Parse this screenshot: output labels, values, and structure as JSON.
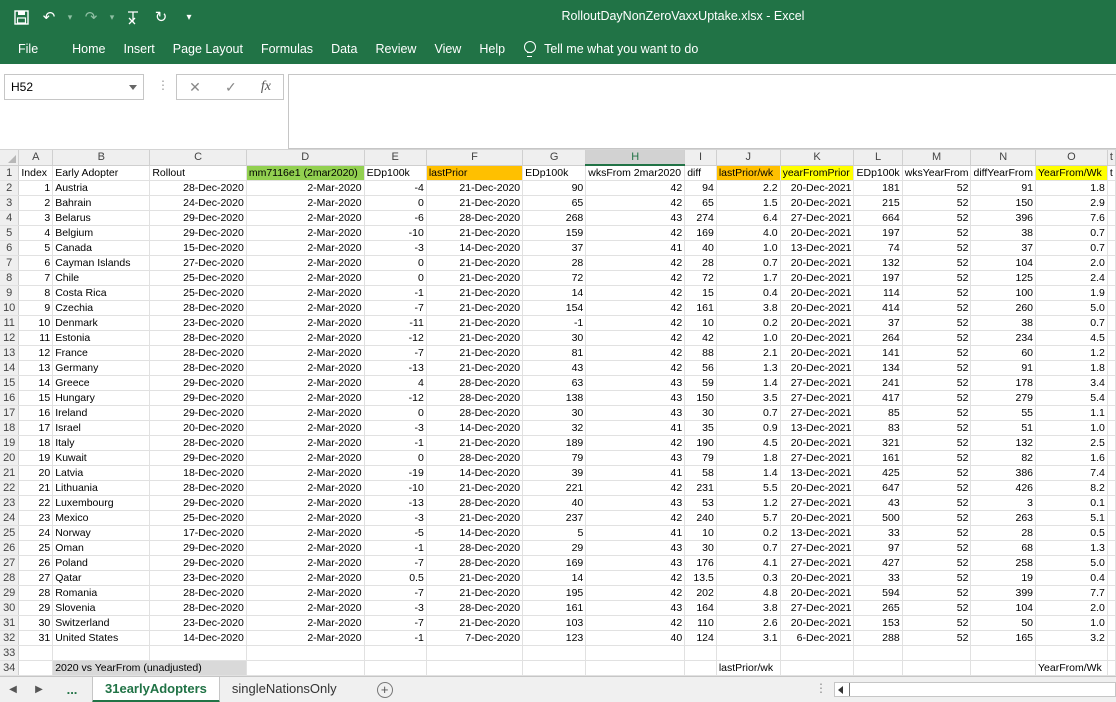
{
  "app": {
    "title": "RolloutDayNonZeroVaxxUptake.xlsx  -  Excel",
    "accent_color": "#217346"
  },
  "qat": {
    "icons": [
      "save-icon",
      "undo-icon",
      "redo-icon",
      "clear-format-icon",
      "refresh-icon",
      "customize-qat-icon"
    ]
  },
  "menu": {
    "items": [
      "File",
      "Home",
      "Insert",
      "Page Layout",
      "Formulas",
      "Data",
      "Review",
      "View",
      "Help"
    ],
    "tell_me": "Tell me what you want to do"
  },
  "formula_bar": {
    "name_box": "H52",
    "fx_label": "fx",
    "value": ""
  },
  "columns": [
    "A",
    "B",
    "C",
    "D",
    "E",
    "F",
    "G",
    "H",
    "I",
    "J",
    "K",
    "L",
    "M",
    "N",
    "O",
    "t"
  ],
  "selected_column": "H",
  "header_row": {
    "row_num": "1",
    "cells": [
      "Index",
      "Early Adopter",
      "Rollout",
      "mm7116e1 (2mar2020)",
      "EDp100k",
      "lastPrior",
      "EDp100k",
      "wksFrom 2mar2020",
      "diff",
      "lastPrior/wk",
      "yearFromPrior",
      "EDp100k",
      "wksYearFrom",
      "diffYearFrom",
      "YearFrom/Wk",
      "t"
    ],
    "highlight_colors": {
      "D": "#92d050",
      "F": "#ffc000",
      "J": "#ffc000",
      "K": "#ffff00",
      "O": "#ffff00"
    }
  },
  "rows": [
    [
      "2",
      "1",
      "Austria",
      "28-Dec-2020",
      "2-Mar-2020",
      "-4",
      "21-Dec-2020",
      "90",
      "42",
      "94",
      "2.2",
      "20-Dec-2021",
      "181",
      "52",
      "91",
      "1.8"
    ],
    [
      "3",
      "2",
      "Bahrain",
      "24-Dec-2020",
      "2-Mar-2020",
      "0",
      "21-Dec-2020",
      "65",
      "42",
      "65",
      "1.5",
      "20-Dec-2021",
      "215",
      "52",
      "150",
      "2.9"
    ],
    [
      "4",
      "3",
      "Belarus",
      "29-Dec-2020",
      "2-Mar-2020",
      "-6",
      "28-Dec-2020",
      "268",
      "43",
      "274",
      "6.4",
      "27-Dec-2021",
      "664",
      "52",
      "396",
      "7.6"
    ],
    [
      "5",
      "4",
      "Belgium",
      "29-Dec-2020",
      "2-Mar-2020",
      "-10",
      "21-Dec-2020",
      "159",
      "42",
      "169",
      "4.0",
      "20-Dec-2021",
      "197",
      "52",
      "38",
      "0.7"
    ],
    [
      "6",
      "5",
      "Canada",
      "15-Dec-2020",
      "2-Mar-2020",
      "-3",
      "14-Dec-2020",
      "37",
      "41",
      "40",
      "1.0",
      "13-Dec-2021",
      "74",
      "52",
      "37",
      "0.7"
    ],
    [
      "7",
      "6",
      "Cayman Islands",
      "27-Dec-2020",
      "2-Mar-2020",
      "0",
      "21-Dec-2020",
      "28",
      "42",
      "28",
      "0.7",
      "20-Dec-2021",
      "132",
      "52",
      "104",
      "2.0"
    ],
    [
      "8",
      "7",
      "Chile",
      "25-Dec-2020",
      "2-Mar-2020",
      "0",
      "21-Dec-2020",
      "72",
      "42",
      "72",
      "1.7",
      "20-Dec-2021",
      "197",
      "52",
      "125",
      "2.4"
    ],
    [
      "9",
      "8",
      "Costa Rica",
      "25-Dec-2020",
      "2-Mar-2020",
      "-1",
      "21-Dec-2020",
      "14",
      "42",
      "15",
      "0.4",
      "20-Dec-2021",
      "114",
      "52",
      "100",
      "1.9"
    ],
    [
      "10",
      "9",
      "Czechia",
      "28-Dec-2020",
      "2-Mar-2020",
      "-7",
      "21-Dec-2020",
      "154",
      "42",
      "161",
      "3.8",
      "20-Dec-2021",
      "414",
      "52",
      "260",
      "5.0"
    ],
    [
      "11",
      "10",
      "Denmark",
      "23-Dec-2020",
      "2-Mar-2020",
      "-11",
      "21-Dec-2020",
      "-1",
      "42",
      "10",
      "0.2",
      "20-Dec-2021",
      "37",
      "52",
      "38",
      "0.7"
    ],
    [
      "12",
      "11",
      "Estonia",
      "28-Dec-2020",
      "2-Mar-2020",
      "-12",
      "21-Dec-2020",
      "30",
      "42",
      "42",
      "1.0",
      "20-Dec-2021",
      "264",
      "52",
      "234",
      "4.5"
    ],
    [
      "13",
      "12",
      "France",
      "28-Dec-2020",
      "2-Mar-2020",
      "-7",
      "21-Dec-2020",
      "81",
      "42",
      "88",
      "2.1",
      "20-Dec-2021",
      "141",
      "52",
      "60",
      "1.2"
    ],
    [
      "14",
      "13",
      "Germany",
      "28-Dec-2020",
      "2-Mar-2020",
      "-13",
      "21-Dec-2020",
      "43",
      "42",
      "56",
      "1.3",
      "20-Dec-2021",
      "134",
      "52",
      "91",
      "1.8"
    ],
    [
      "15",
      "14",
      "Greece",
      "29-Dec-2020",
      "2-Mar-2020",
      "4",
      "28-Dec-2020",
      "63",
      "43",
      "59",
      "1.4",
      "27-Dec-2021",
      "241",
      "52",
      "178",
      "3.4"
    ],
    [
      "16",
      "15",
      "Hungary",
      "29-Dec-2020",
      "2-Mar-2020",
      "-12",
      "28-Dec-2020",
      "138",
      "43",
      "150",
      "3.5",
      "27-Dec-2021",
      "417",
      "52",
      "279",
      "5.4"
    ],
    [
      "17",
      "16",
      "Ireland",
      "29-Dec-2020",
      "2-Mar-2020",
      "0",
      "28-Dec-2020",
      "30",
      "43",
      "30",
      "0.7",
      "27-Dec-2021",
      "85",
      "52",
      "55",
      "1.1"
    ],
    [
      "18",
      "17",
      "Israel",
      "20-Dec-2020",
      "2-Mar-2020",
      "-3",
      "14-Dec-2020",
      "32",
      "41",
      "35",
      "0.9",
      "13-Dec-2021",
      "83",
      "52",
      "51",
      "1.0"
    ],
    [
      "19",
      "18",
      "Italy",
      "28-Dec-2020",
      "2-Mar-2020",
      "-1",
      "21-Dec-2020",
      "189",
      "42",
      "190",
      "4.5",
      "20-Dec-2021",
      "321",
      "52",
      "132",
      "2.5"
    ],
    [
      "20",
      "19",
      "Kuwait",
      "29-Dec-2020",
      "2-Mar-2020",
      "0",
      "28-Dec-2020",
      "79",
      "43",
      "79",
      "1.8",
      "27-Dec-2021",
      "161",
      "52",
      "82",
      "1.6"
    ],
    [
      "21",
      "20",
      "Latvia",
      "18-Dec-2020",
      "2-Mar-2020",
      "-19",
      "14-Dec-2020",
      "39",
      "41",
      "58",
      "1.4",
      "13-Dec-2021",
      "425",
      "52",
      "386",
      "7.4"
    ],
    [
      "22",
      "21",
      "Lithuania",
      "28-Dec-2020",
      "2-Mar-2020",
      "-10",
      "21-Dec-2020",
      "221",
      "42",
      "231",
      "5.5",
      "20-Dec-2021",
      "647",
      "52",
      "426",
      "8.2"
    ],
    [
      "23",
      "22",
      "Luxembourg",
      "29-Dec-2020",
      "2-Mar-2020",
      "-13",
      "28-Dec-2020",
      "40",
      "43",
      "53",
      "1.2",
      "27-Dec-2021",
      "43",
      "52",
      "3",
      "0.1"
    ],
    [
      "24",
      "23",
      "Mexico",
      "25-Dec-2020",
      "2-Mar-2020",
      "-3",
      "21-Dec-2020",
      "237",
      "42",
      "240",
      "5.7",
      "20-Dec-2021",
      "500",
      "52",
      "263",
      "5.1"
    ],
    [
      "25",
      "24",
      "Norway",
      "17-Dec-2020",
      "2-Mar-2020",
      "-5",
      "14-Dec-2020",
      "5",
      "41",
      "10",
      "0.2",
      "13-Dec-2021",
      "33",
      "52",
      "28",
      "0.5"
    ],
    [
      "26",
      "25",
      "Oman",
      "29-Dec-2020",
      "2-Mar-2020",
      "-1",
      "28-Dec-2020",
      "29",
      "43",
      "30",
      "0.7",
      "27-Dec-2021",
      "97",
      "52",
      "68",
      "1.3"
    ],
    [
      "27",
      "26",
      "Poland",
      "29-Dec-2020",
      "2-Mar-2020",
      "-7",
      "28-Dec-2020",
      "169",
      "43",
      "176",
      "4.1",
      "27-Dec-2021",
      "427",
      "52",
      "258",
      "5.0"
    ],
    [
      "28",
      "27",
      "Qatar",
      "23-Dec-2020",
      "2-Mar-2020",
      "0.5",
      "21-Dec-2020",
      "14",
      "42",
      "13.5",
      "0.3",
      "20-Dec-2021",
      "33",
      "52",
      "19",
      "0.4"
    ],
    [
      "29",
      "28",
      "Romania",
      "28-Dec-2020",
      "2-Mar-2020",
      "-7",
      "21-Dec-2020",
      "195",
      "42",
      "202",
      "4.8",
      "20-Dec-2021",
      "594",
      "52",
      "399",
      "7.7"
    ],
    [
      "30",
      "29",
      "Slovenia",
      "28-Dec-2020",
      "2-Mar-2020",
      "-3",
      "28-Dec-2020",
      "161",
      "43",
      "164",
      "3.8",
      "27-Dec-2021",
      "265",
      "52",
      "104",
      "2.0"
    ],
    [
      "31",
      "30",
      "Switzerland",
      "23-Dec-2020",
      "2-Mar-2020",
      "-7",
      "21-Dec-2020",
      "103",
      "42",
      "110",
      "2.6",
      "20-Dec-2021",
      "153",
      "52",
      "50",
      "1.0"
    ],
    [
      "32",
      "31",
      "United States",
      "14-Dec-2020",
      "2-Mar-2020",
      "-1",
      "7-Dec-2020",
      "123",
      "40",
      "124",
      "3.1",
      "6-Dec-2021",
      "288",
      "52",
      "165",
      "3.2"
    ]
  ],
  "empty_row": "33",
  "footer_row": {
    "row_num": "34",
    "b_label": "2020 vs YearFrom (unadjusted)",
    "j_label": "lastPrior/wk",
    "o_label": "YearFrom/Wk"
  },
  "tabs": {
    "more": "...",
    "items": [
      {
        "label": "31earlyAdopters",
        "active": true
      },
      {
        "label": "singleNationsOnly",
        "active": false
      }
    ],
    "add_label": "+"
  }
}
